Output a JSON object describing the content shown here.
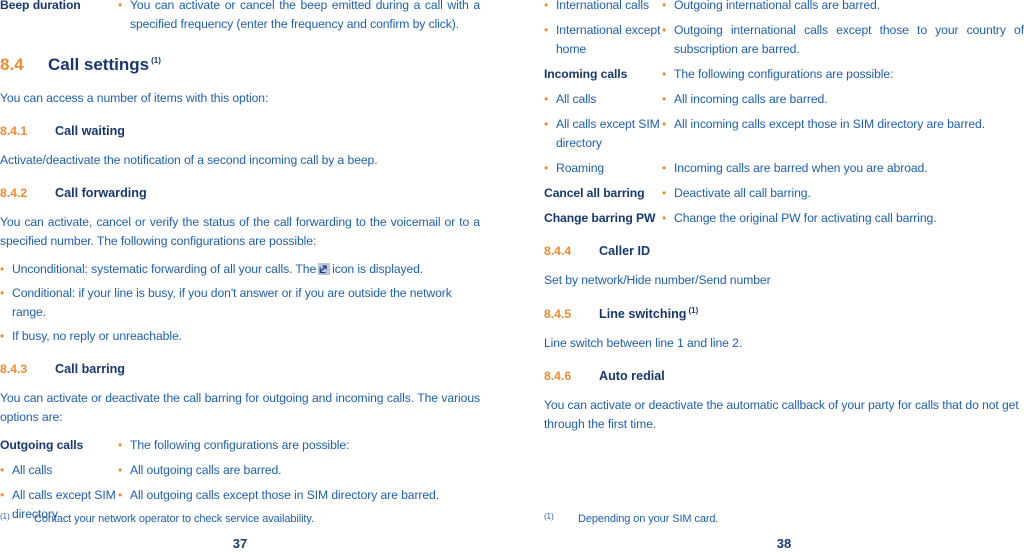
{
  "document": {
    "colors": {
      "heading_navy": "#17386e",
      "accent_orange": "#ec8b33",
      "body_blue": "#1f5fad",
      "page_background": "#ffffff"
    }
  },
  "left_page": {
    "folio": "37",
    "beep_row": {
      "term": "Beep duration",
      "bullet": "•",
      "description": "You can activate or cancel the beep emitted during a call with a specified frequency (enter the frequency and confirm by click)."
    },
    "section": {
      "number": "8.4",
      "title": "Call settings",
      "footnote_marker": "(1)"
    },
    "intro": "You can access a number of items with this option:",
    "sub_8_4_1": {
      "number": "8.4.1",
      "title": "Call waiting",
      "body": "Activate/deactivate the notification of a second incoming call by a beep."
    },
    "sub_8_4_2": {
      "number": "8.4.2",
      "title": "Call forwarding",
      "body": "You can activate, cancel or verify the status of the call forwarding to the voicemail or to a specified number. The following configurations are possible:",
      "bullets": [
        {
          "bullet": "•",
          "text_before": "Unconditional: systematic forwarding of all your calls. The",
          "icon": "call-forwarding-icon",
          "text_after": "icon is displayed."
        },
        {
          "bullet": "•",
          "text": "Conditional: if your line is busy, if you don't answer or if you are outside the network range."
        },
        {
          "bullet": "•",
          "text": "If busy, no reply or unreachable."
        }
      ]
    },
    "sub_8_4_3": {
      "number": "8.4.3",
      "title": "Call barring",
      "body": "You can activate or deactivate the call barring for outgoing and incoming calls. The various options are:",
      "rows": [
        {
          "bold": true,
          "term": "Outgoing calls",
          "bullet": "•",
          "desc": "The following configurations are possible:"
        },
        {
          "bold": false,
          "term": "All calls",
          "bullet": "•",
          "desc": "All outgoing calls are barred.",
          "term_bullet": "•"
        },
        {
          "bold": false,
          "term": "All calls except SIM directory",
          "bullet": "•",
          "desc": "All outgoing calls except those in SIM directory are barred.",
          "term_bullet": "•"
        }
      ]
    },
    "footnote": {
      "marker": "(1)",
      "text": "Contact your network operator to check service availability."
    }
  },
  "right_page": {
    "folio": "38",
    "barring_rows": [
      {
        "bold": false,
        "term_bullet": "•",
        "term": "International calls",
        "bullet": "•",
        "desc": "Outgoing international calls are barred."
      },
      {
        "bold": false,
        "term_bullet": "•",
        "term": "International except home",
        "bullet": "•",
        "desc": "Outgoing international calls except those to your country of subscription are barred."
      },
      {
        "bold": true,
        "term_bullet": "",
        "term": "Incoming calls",
        "bullet": "•",
        "desc": "The following configurations are possible:"
      },
      {
        "bold": false,
        "term_bullet": "•",
        "term": "All calls",
        "bullet": "•",
        "desc": "All incoming calls are barred."
      },
      {
        "bold": false,
        "term_bullet": "•",
        "term": "All calls except SIM directory",
        "bullet": "•",
        "desc": "All incoming calls except those in SIM directory are barred."
      },
      {
        "bold": false,
        "term_bullet": "•",
        "term": "Roaming",
        "bullet": "•",
        "desc": "Incoming calls are barred when you are abroad."
      },
      {
        "bold": true,
        "term_bullet": "",
        "term": "Cancel all barring",
        "bullet": "•",
        "desc": "Deactivate all call barring."
      },
      {
        "bold": true,
        "term_bullet": "",
        "term": "Change barring PW",
        "bullet": "•",
        "desc": "Change the original PW for activating call barring."
      }
    ],
    "sub_8_4_4": {
      "number": "8.4.4",
      "title": "Caller ID",
      "body": "Set by network/Hide number/Send number"
    },
    "sub_8_4_5": {
      "number": "8.4.5",
      "title": "Line switching",
      "footnote_marker": "(1)",
      "body": "Line switch between line 1 and line 2."
    },
    "sub_8_4_6": {
      "number": "8.4.6",
      "title": "Auto redial",
      "body": "You can activate or deactivate the automatic callback of your party for calls that do not get through the first time."
    },
    "footnote": {
      "marker": "(1)",
      "text": "Depending on your SIM card."
    }
  }
}
